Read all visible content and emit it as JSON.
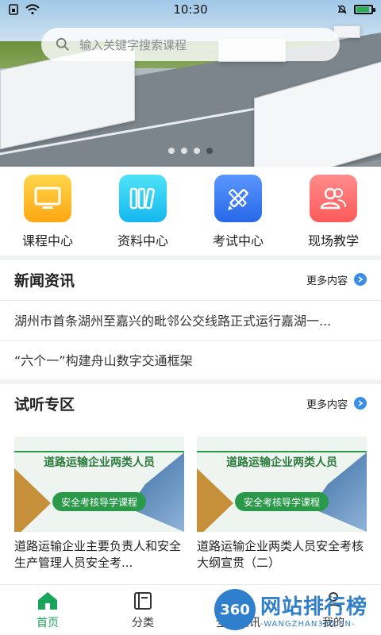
{
  "status_bar": {
    "time": "10:30",
    "battery_percent": 80
  },
  "search": {
    "placeholder": "输入关键字搜索课程"
  },
  "banner": {
    "dots": 4,
    "active_index": 3
  },
  "quick_menu": [
    {
      "label": "课程中心",
      "icon": "monitor-icon"
    },
    {
      "label": "资料中心",
      "icon": "books-icon"
    },
    {
      "label": "考试中心",
      "icon": "pencil-ruler-icon"
    },
    {
      "label": "现场教学",
      "icon": "people-icon"
    }
  ],
  "news": {
    "title": "新闻资讯",
    "more": "更多内容",
    "items": [
      "湖州市首条湖州至嘉兴的毗邻公交线路正式运行嘉湖一...",
      "“六个一”构建舟山数字交通框架"
    ]
  },
  "trial": {
    "title": "试听专区",
    "more": "更多内容",
    "cards": [
      {
        "banner_title": "道路运输企业两类人员",
        "banner_pill": "安全考核导学课程",
        "title": "道路运输企业主要负责人和安全生产管理人员安全考..."
      },
      {
        "banner_title": "道路运输企业两类人员",
        "banner_pill": "安全考核导学课程",
        "title": "道路运输企业两类人员安全考核大纲宣贯（二）"
      }
    ]
  },
  "tabbar": [
    {
      "label": "首页",
      "icon": "home-icon",
      "active": true
    },
    {
      "label": "分类",
      "icon": "book-icon",
      "active": false
    },
    {
      "label": "全部资讯",
      "icon": "news-icon",
      "active": false
    },
    {
      "label": "我的",
      "icon": "user-icon",
      "active": false
    }
  ],
  "watermark": {
    "badge": "360",
    "cn": "网站排行榜",
    "en": "-WANGZHAN360.CN-"
  },
  "colors": {
    "accent_green": "#1aa35a",
    "link_blue": "#3a8ee6"
  }
}
